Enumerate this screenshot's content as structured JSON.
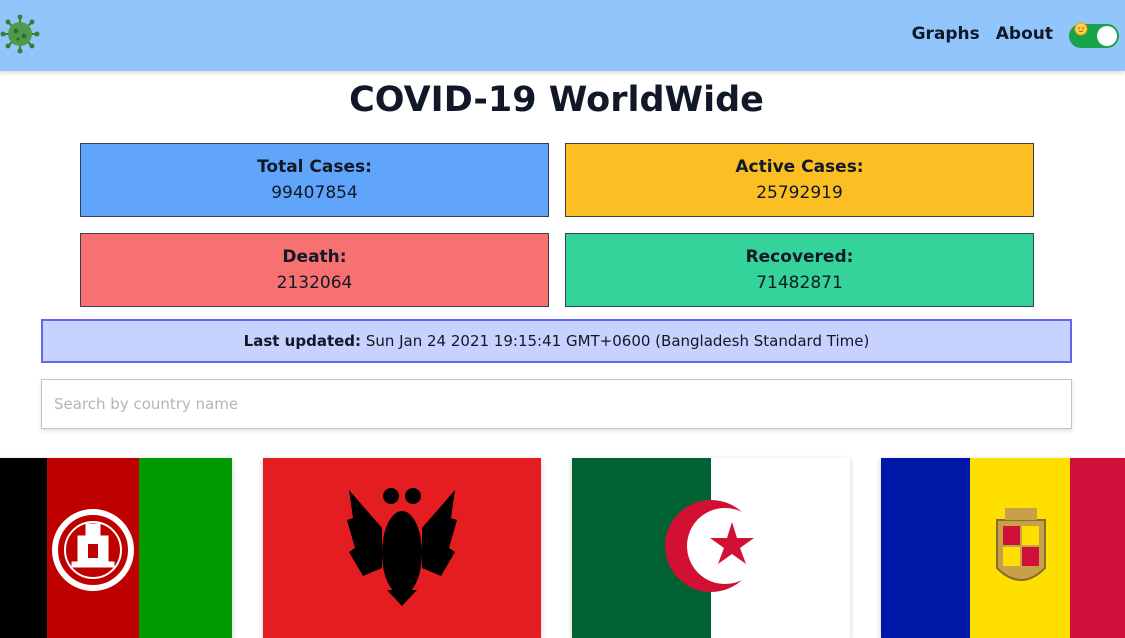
{
  "navbar": {
    "logo_icon": "virus-icon",
    "links": [
      {
        "label": "Graphs"
      },
      {
        "label": "About"
      }
    ],
    "theme_toggle": {
      "icon": "sun-icon",
      "state": "on",
      "color": "#16a34a"
    }
  },
  "page_title": "COVID-19 WorldWide",
  "stats": {
    "total": {
      "label": "Total Cases:",
      "value": "99407854",
      "color": "#60a5fa"
    },
    "active": {
      "label": "Active Cases:",
      "value": "25792919",
      "color": "#fbbf24"
    },
    "death": {
      "label": "Death:",
      "value": "2132064",
      "color": "#f87171"
    },
    "recovered": {
      "label": "Recovered:",
      "value": "71482871",
      "color": "#34d399"
    }
  },
  "last_updated": {
    "label": "Last updated:",
    "value": "Sun Jan 24 2021 19:15:41 GMT+0600 (Bangladesh Standard Time)"
  },
  "search": {
    "placeholder": "Search by country name",
    "value": ""
  },
  "countries": [
    {
      "flag_icon": "afghanistan-flag-icon"
    },
    {
      "flag_icon": "albania-flag-icon"
    },
    {
      "flag_icon": "algeria-flag-icon"
    },
    {
      "flag_icon": "andorra-flag-icon"
    }
  ]
}
